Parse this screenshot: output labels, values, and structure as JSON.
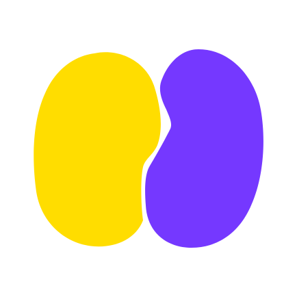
{
  "logo": {
    "icon": "two-blob-logo-icon",
    "colors": {
      "background": "#ffffff",
      "left_blob": "#FFDD00",
      "right_blob": "#7538FF"
    }
  }
}
